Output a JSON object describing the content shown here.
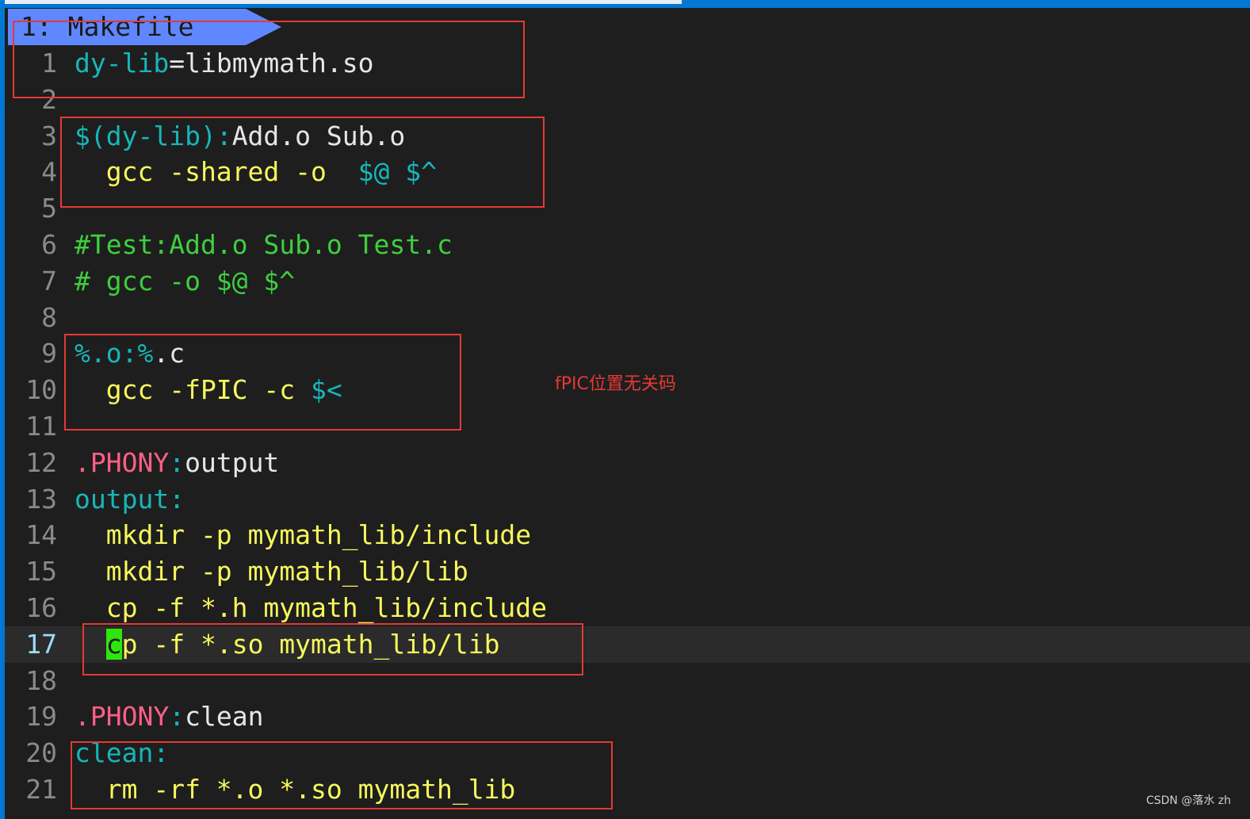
{
  "tab": {
    "label": "1: Makefile"
  },
  "lines": [
    {
      "num": "1",
      "tokens": [
        {
          "t": "dy-lib",
          "k": "target"
        },
        {
          "t": "=libmymath.so",
          "k": "text"
        }
      ]
    },
    {
      "num": "2",
      "tokens": []
    },
    {
      "num": "3",
      "tokens": [
        {
          "t": "$(dy-lib)",
          "k": "var"
        },
        {
          "t": ":",
          "k": "target"
        },
        {
          "t": "Add.o Sub.o",
          "k": "text"
        }
      ]
    },
    {
      "num": "4",
      "tokens": [
        {
          "t": "  gcc -shared -o  ",
          "k": "cmd"
        },
        {
          "t": "$@ $^",
          "k": "var"
        }
      ]
    },
    {
      "num": "5",
      "tokens": []
    },
    {
      "num": "6",
      "tokens": [
        {
          "t": "#Test:Add.o Sub.o Test.c",
          "k": "comment"
        }
      ]
    },
    {
      "num": "7",
      "tokens": [
        {
          "t": "# gcc -o $@ $^",
          "k": "comment"
        }
      ]
    },
    {
      "num": "8",
      "tokens": []
    },
    {
      "num": "9",
      "tokens": [
        {
          "t": "%.o:%",
          "k": "target"
        },
        {
          "t": ".c",
          "k": "text"
        }
      ]
    },
    {
      "num": "10",
      "tokens": [
        {
          "t": "  gcc -fPIC -c ",
          "k": "cmd"
        },
        {
          "t": "$<",
          "k": "var"
        }
      ]
    },
    {
      "num": "11",
      "tokens": []
    },
    {
      "num": "12",
      "tokens": [
        {
          "t": ".PHONY",
          "k": "phony"
        },
        {
          "t": ":",
          "k": "target"
        },
        {
          "t": "output",
          "k": "text"
        }
      ]
    },
    {
      "num": "13",
      "tokens": [
        {
          "t": "output:",
          "k": "target"
        }
      ]
    },
    {
      "num": "14",
      "tokens": [
        {
          "t": "  mkdir -p mymath_lib/include",
          "k": "cmd"
        }
      ]
    },
    {
      "num": "15",
      "tokens": [
        {
          "t": "  mkdir -p mymath_lib/lib",
          "k": "cmd"
        }
      ]
    },
    {
      "num": "16",
      "tokens": [
        {
          "t": "  cp -f *.h mymath_lib/include",
          "k": "cmd"
        }
      ]
    },
    {
      "num": "17",
      "current": true,
      "tokens": [
        {
          "t": "  ",
          "k": "cmd"
        },
        {
          "t": "c",
          "k": "cursor"
        },
        {
          "t": "p -f *.so mymath_lib/lib",
          "k": "cmd"
        }
      ]
    },
    {
      "num": "18",
      "tokens": []
    },
    {
      "num": "19",
      "tokens": [
        {
          "t": ".PHONY",
          "k": "phony"
        },
        {
          "t": ":",
          "k": "target"
        },
        {
          "t": "clean",
          "k": "text"
        }
      ]
    },
    {
      "num": "20",
      "tokens": [
        {
          "t": "clean:",
          "k": "target"
        }
      ]
    },
    {
      "num": "21",
      "tokens": [
        {
          "t": "  rm -rf *.o *.so mymath_lib",
          "k": "cmd"
        }
      ]
    }
  ],
  "annotation": {
    "note": "fPIC位置无关码",
    "color": "#e53935"
  },
  "watermark": "CSDN @落水 zh",
  "colors": {
    "target": "#17b6b9",
    "command": "#f7f75c",
    "comment": "#3ecf3e",
    "phony": "#ff5f87",
    "cursor": "#2ee60f",
    "tab": "#5f87ff"
  }
}
